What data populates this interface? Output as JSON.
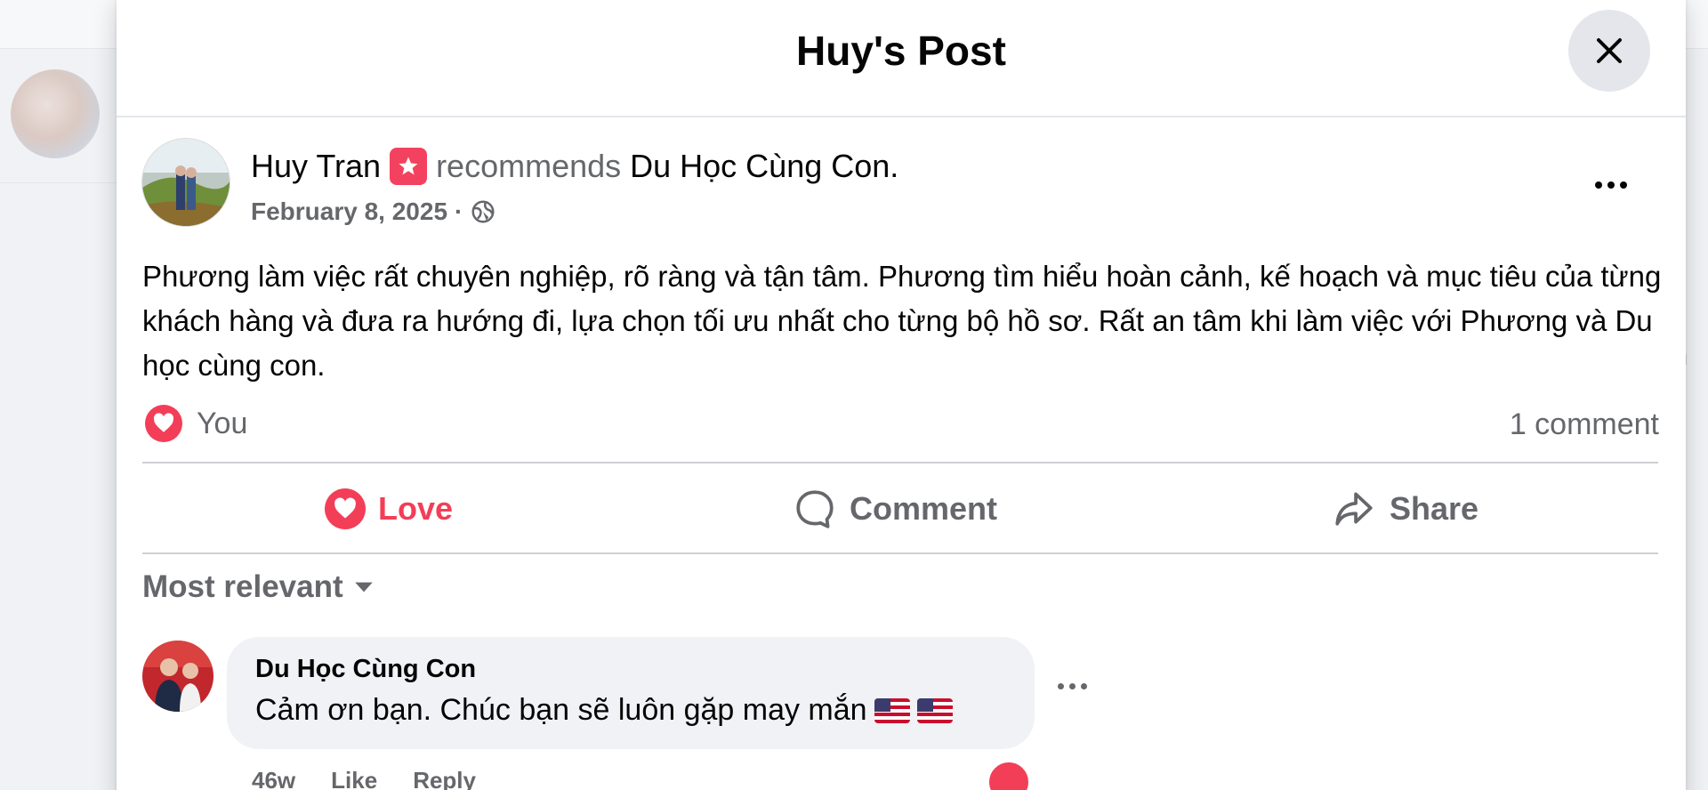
{
  "modal": {
    "title": "Huy's Post"
  },
  "post": {
    "author": "Huy Tran",
    "verb": "recommends",
    "page": "Du Học Cùng Con",
    "period": ".",
    "date": "February 8, 2025",
    "separator": "·",
    "privacy_icon": "globe-icon",
    "text": "Phương làm việc rất chuyên nghiệp, rõ ràng và tận tâm. Phương tìm hiểu hoàn cảnh, kế hoạch và mục tiêu của từng khách hàng và đưa ra hướng đi, lựa chọn tối ưu nhất cho từng bộ hồ sơ. Rất an tâm khi làm việc với Phương và Du học cùng con.",
    "reaction_names": "You",
    "comment_count": "1 comment"
  },
  "actions": {
    "love": "Love",
    "comment": "Comment",
    "share": "Share"
  },
  "comments": {
    "sort_label": "Most relevant",
    "items": [
      {
        "author": "Du Học Cùng Con",
        "text": "Cảm ơn bạn. Chúc bạn sẽ luôn gặp may mắn",
        "time": "46w",
        "like": "Like",
        "reply": "Reply"
      }
    ]
  },
  "colors": {
    "love": "#f33e58",
    "secondary_text": "#65676b",
    "bubble": "#f0f2f5"
  }
}
